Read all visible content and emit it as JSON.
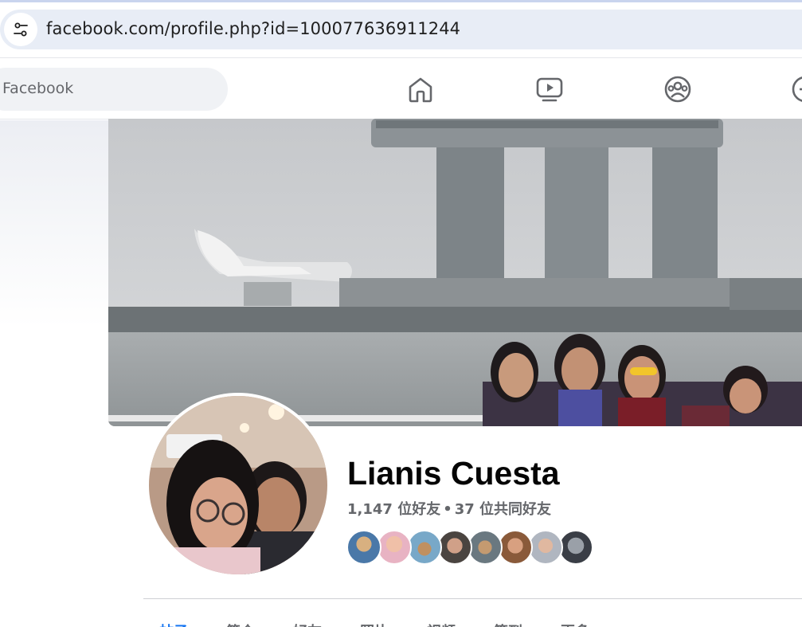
{
  "browser": {
    "url": "facebook.com/profile.php?id=100077636911244",
    "site_info_icon": "tune-icon"
  },
  "nav": {
    "search_placeholder": "Facebook",
    "icons": [
      "home-icon",
      "video-icon",
      "groups-icon",
      "add-icon"
    ]
  },
  "profile": {
    "name": "Lianis Cuesta",
    "friend_count": "1,147 位好友",
    "separator": "•",
    "mutual_count": "37 位共同好友",
    "mutual_friend_avatars": 8
  },
  "tabs": [
    {
      "label": "帖子",
      "active": true
    },
    {
      "label": "简介",
      "active": false
    },
    {
      "label": "好友",
      "active": false
    },
    {
      "label": "照片",
      "active": false
    },
    {
      "label": "视频",
      "active": false
    },
    {
      "label": "签到",
      "active": false
    },
    {
      "label": "更多",
      "active": false
    }
  ],
  "colors": {
    "accent": "#1877f2",
    "text_primary": "#050505",
    "text_secondary": "#65676b",
    "address_bar": "#e8edf6",
    "search_bg": "#f0f2f5"
  }
}
